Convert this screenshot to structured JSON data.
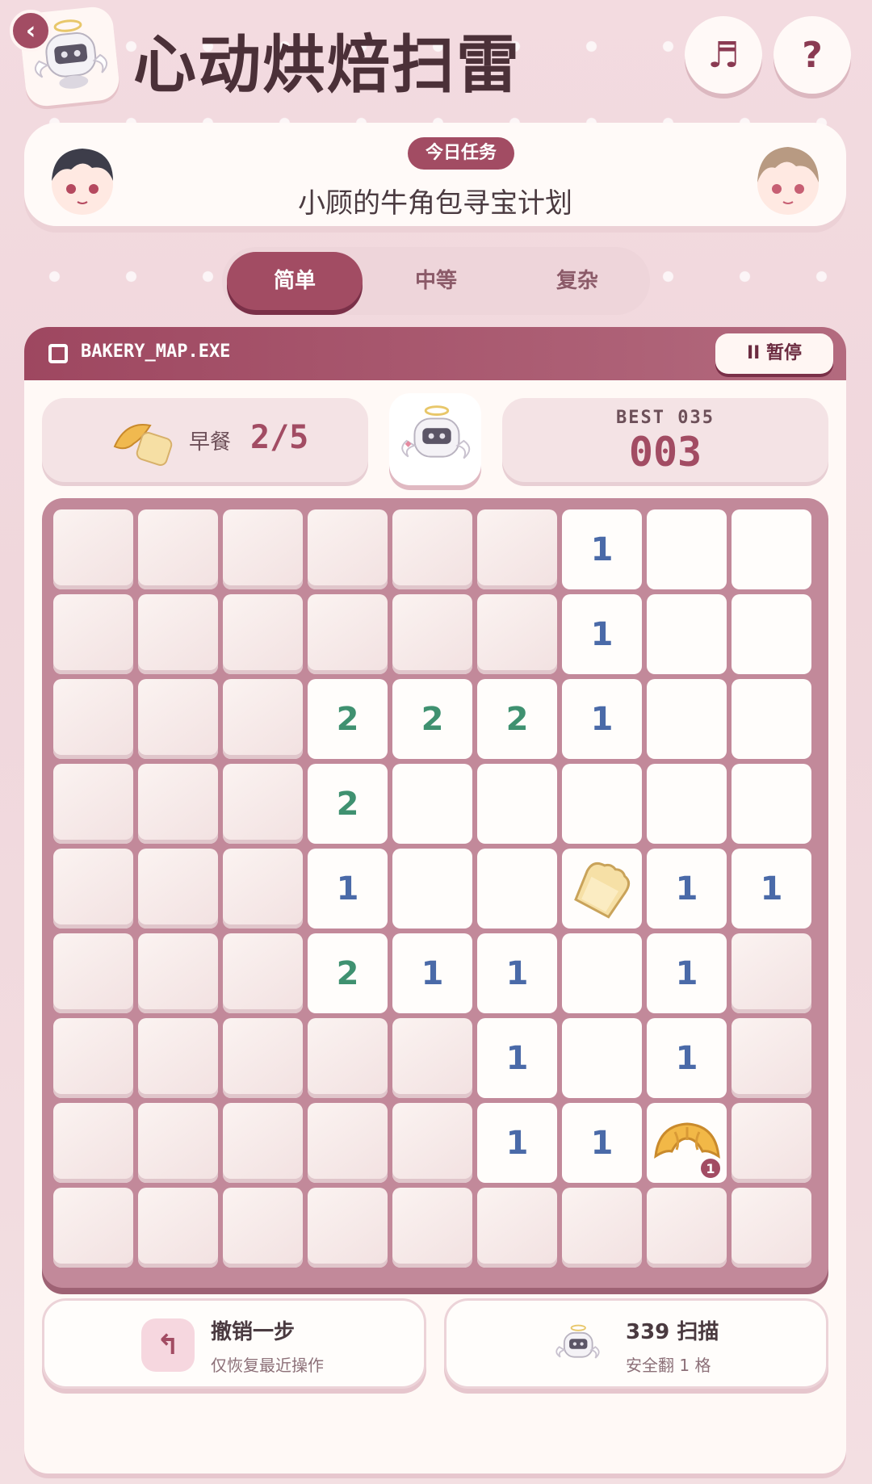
{
  "header": {
    "title": "心动烘焙扫雷",
    "back_icon": "chevron-left-icon",
    "music_label": "♬",
    "help_label": "?"
  },
  "task": {
    "badge": "今日任务",
    "title": "小顾的牛角包寻宝计划"
  },
  "difficulty": {
    "tabs": [
      "简单",
      "中等",
      "复杂"
    ],
    "selected": "简单"
  },
  "window": {
    "file_name": "BAKERY_MAP.EXE",
    "pause_label": "II 暂停"
  },
  "stats": {
    "breakfast_label": "早餐",
    "breakfast_value": "2/5",
    "best_label": "BEST 035",
    "timer": "003"
  },
  "board": {
    "rows": 9,
    "cols": 9,
    "cells": [
      [
        "h",
        "h",
        "h",
        "h",
        "h",
        "h",
        "1",
        "o",
        "o"
      ],
      [
        "h",
        "h",
        "h",
        "h",
        "h",
        "h",
        "1",
        "o",
        "o"
      ],
      [
        "h",
        "h",
        "h",
        "2",
        "2",
        "2",
        "1",
        "o",
        "o"
      ],
      [
        "h",
        "h",
        "h",
        "2",
        "o",
        "o",
        "o",
        "o",
        "o"
      ],
      [
        "h",
        "h",
        "h",
        "1",
        "o",
        "o",
        "toast",
        "1",
        "1"
      ],
      [
        "h",
        "h",
        "h",
        "2",
        "1",
        "1",
        "o",
        "1",
        "h"
      ],
      [
        "h",
        "h",
        "h",
        "h",
        "h",
        "1",
        "o",
        "1",
        "h"
      ],
      [
        "h",
        "h",
        "h",
        "h",
        "h",
        "1",
        "1",
        "croissant",
        "h"
      ],
      [
        "h",
        "h",
        "h",
        "h",
        "h",
        "h",
        "h",
        "h",
        "h"
      ]
    ],
    "croissant_badge": "1"
  },
  "actions": {
    "undo_title": "撤销一步",
    "undo_sub": "仅恢复最近操作",
    "scan_title": "339 扫描",
    "scan_sub": "安全翻 1 格"
  },
  "colors": {
    "accent": "#a24c63",
    "number_one": "#4a6aa8",
    "number_two": "#3f9170",
    "background": "#f3dbe0"
  }
}
